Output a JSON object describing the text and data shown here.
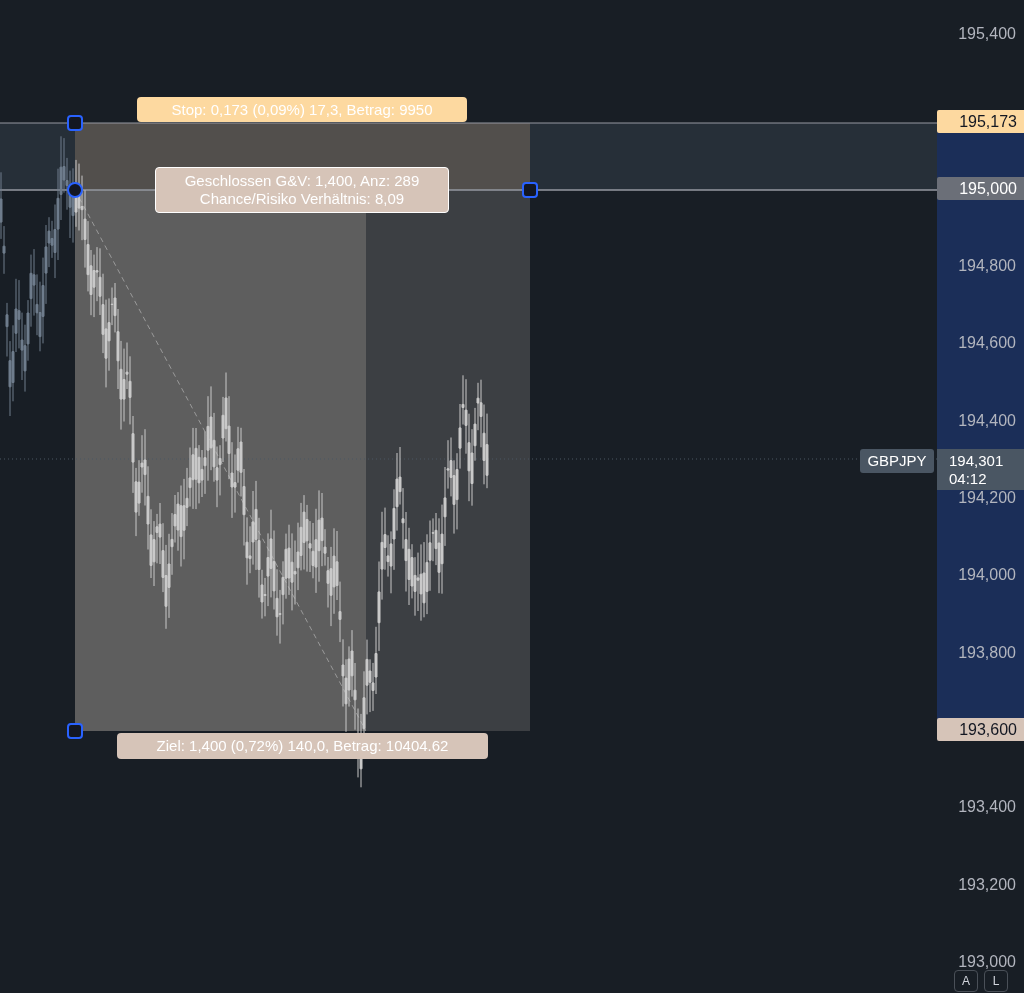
{
  "position_tool": {
    "stop_label": "Stop: 0,173 (0,09%) 17,3, Betrag: 9950",
    "summary": [
      "Geschlossen G&V: 1,400, Anz: 289",
      "Chance/Risiko Verhältnis: 8,09"
    ],
    "target_label": "Ziel: 1,400 (0,72%) 140,0, Betrag: 10404.62"
  },
  "price_axis": {
    "ticks": [
      "195,400",
      "194,800",
      "194,600",
      "194,400",
      "194,200",
      "194,000",
      "193,800",
      "193,400",
      "193,200",
      "193,000"
    ]
  },
  "markers": [
    {
      "kind": "stop",
      "text": "195,173"
    },
    {
      "kind": "entry",
      "text": "195,000"
    },
    {
      "kind": "target",
      "text": "193,600"
    }
  ],
  "current_price": {
    "symbol": "GBPJPY",
    "price": "194,301",
    "countdown": "04:12"
  },
  "buttons": [
    "A",
    "L"
  ]
}
